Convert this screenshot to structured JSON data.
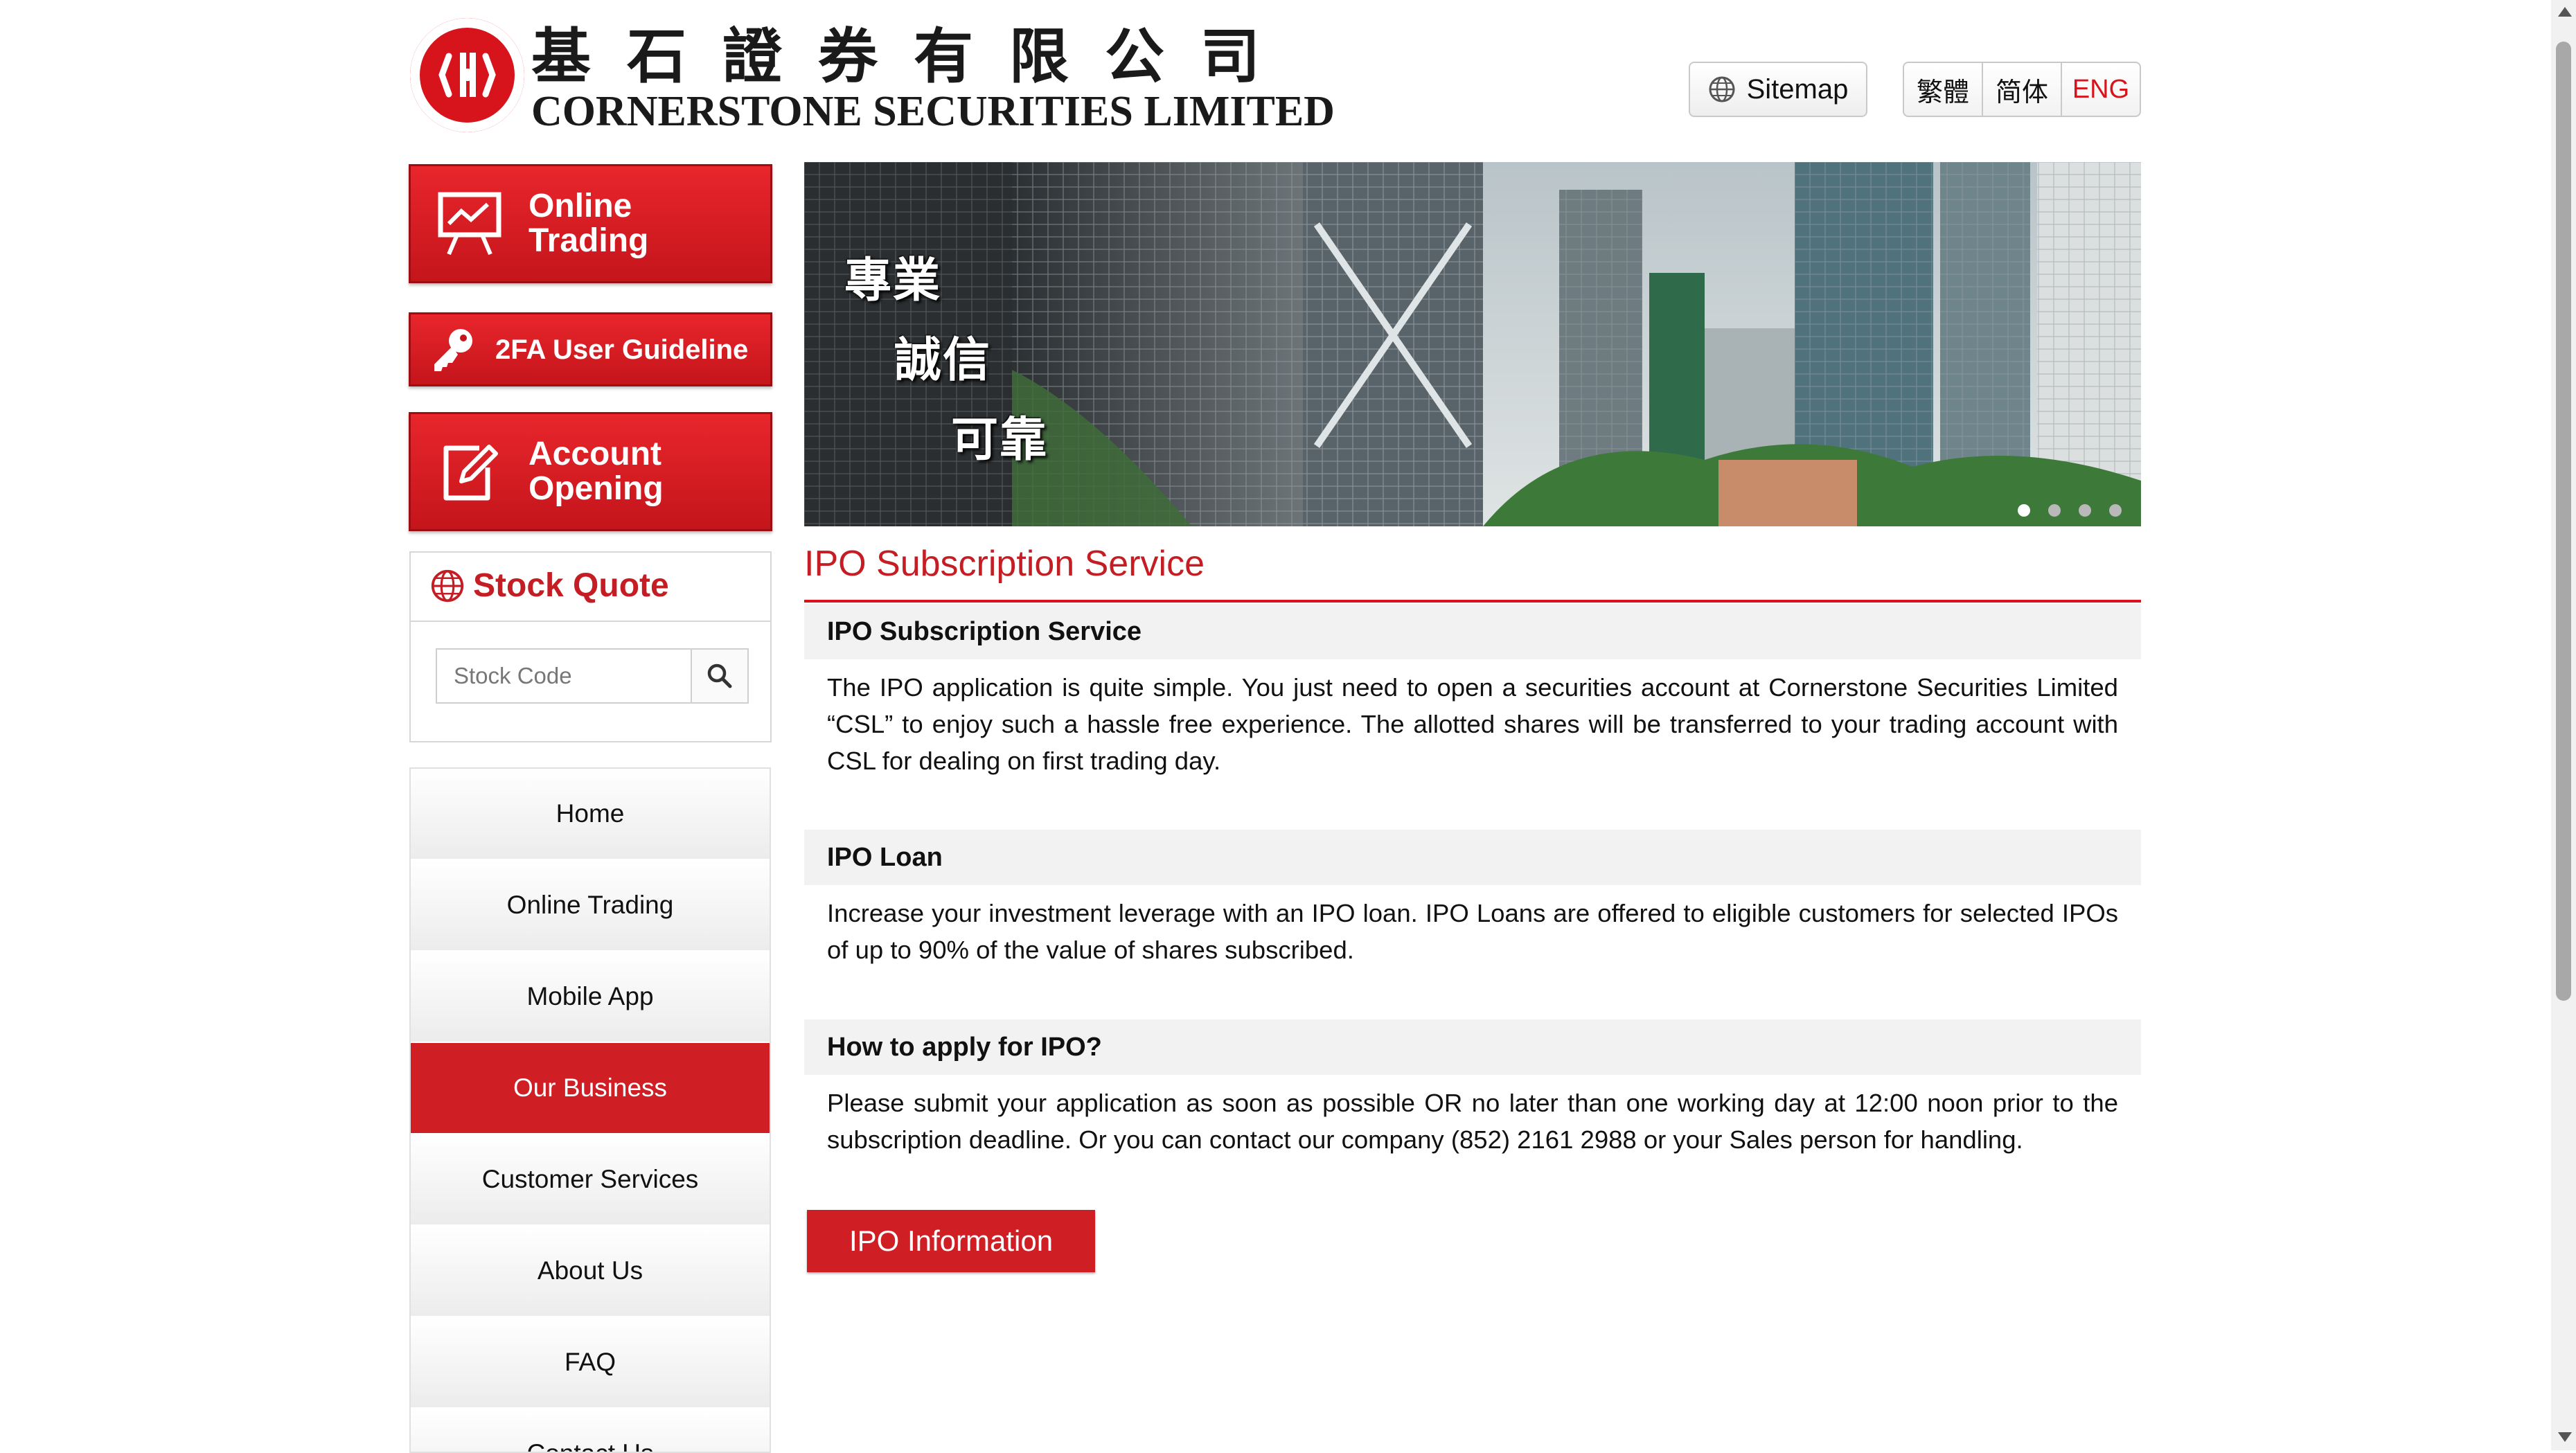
{
  "header": {
    "logo_cn": "基石證券有限公司",
    "logo_en": "CORNERSTONE SECURITIES LIMITED",
    "sitemap_label": "Sitemap",
    "languages": [
      "繁體",
      "简体",
      "ENG"
    ],
    "active_language": "ENG"
  },
  "sidebar": {
    "buttons": {
      "online_trading": "Online Trading",
      "guideline": "2FA User Guideline",
      "account_opening": "Account Opening"
    },
    "stock_quote": {
      "title": "Stock Quote",
      "placeholder": "Stock Code"
    },
    "nav": [
      "Home",
      "Online Trading",
      "Mobile App",
      "Our Business",
      "Customer Services",
      "About Us",
      "FAQ",
      "Contact Us"
    ],
    "active_nav": "Our Business"
  },
  "banner": {
    "text_lines": [
      "專業",
      "誠信",
      "可靠"
    ],
    "slides": 4,
    "active_slide": 1
  },
  "main": {
    "page_title": "IPO Subscription Service",
    "sections": [
      {
        "heading": "IPO Subscription Service",
        "body": "The IPO application is quite simple. You just need to open a securities account at Cornerstone Securities Limited “CSL” to enjoy such a hassle free experience. The allotted shares will be transferred to your trading account with CSL for dealing on first trading day."
      },
      {
        "heading": "IPO Loan",
        "body": "Increase your investment leverage with an IPO loan. IPO Loans are offered to eligible customers for selected IPOs of up to 90% of the value of shares subscribed."
      },
      {
        "heading": "How to apply for IPO?",
        "body": "Please submit your application as soon as possible OR no later than one working day at 12:00 noon prior to the subscription deadline. Or you can contact our company (852) 2161 2988 or your Sales person for handling."
      }
    ],
    "ipo_button": "IPO Information"
  },
  "colors": {
    "brand_red": "#d7141b",
    "title_red": "#c41e24"
  }
}
